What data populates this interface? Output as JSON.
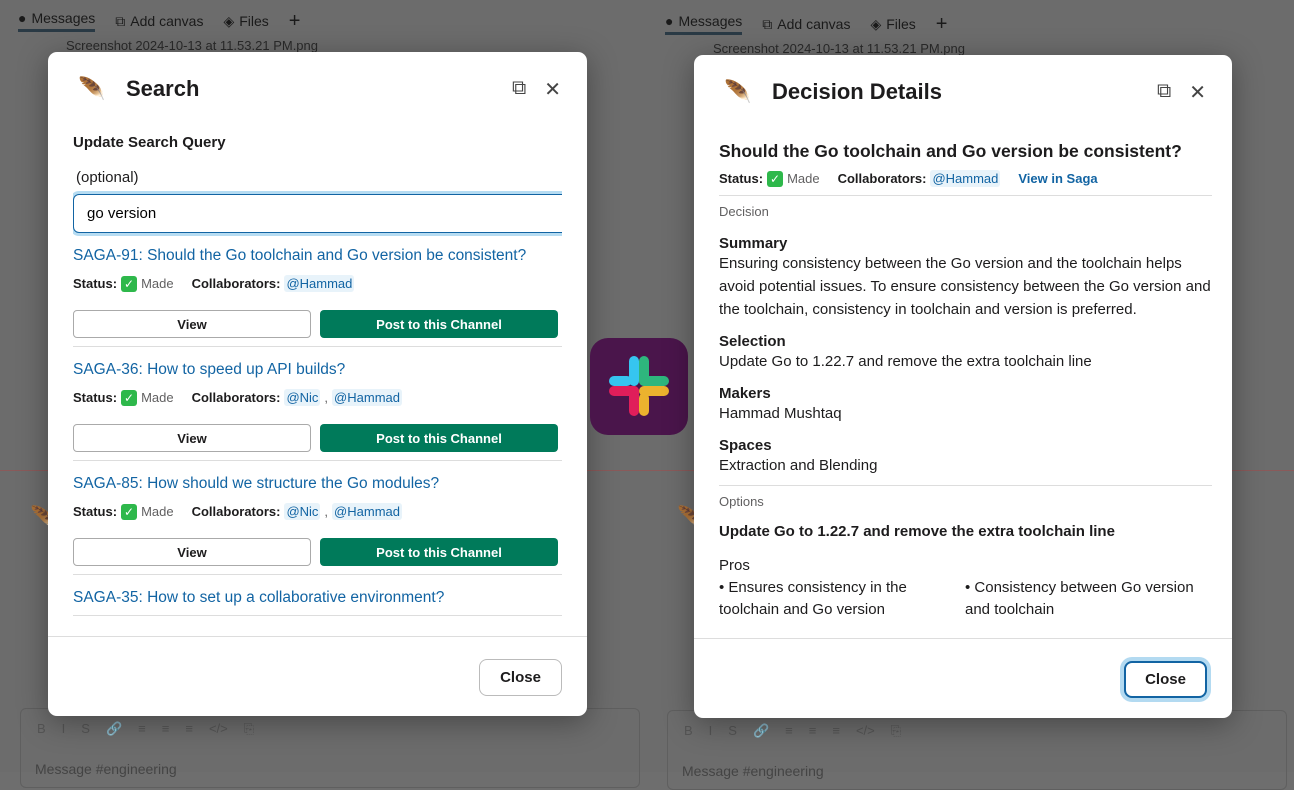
{
  "background": {
    "tabs": [
      {
        "icon": "message-bubble-icon",
        "label": "Messages"
      },
      {
        "icon": "canvas-icon",
        "label": "Add canvas"
      },
      {
        "icon": "layers-icon",
        "label": "Files"
      }
    ],
    "add_tab": "+",
    "file_name": "Screenshot 2024-10-13 at 11.53.21 PM.png",
    "composer_placeholder": "Message #engineering",
    "format_buttons": [
      "B",
      "I",
      "S",
      "🔗",
      "≡",
      "≡",
      "≡",
      "</>",
      "⎘"
    ]
  },
  "search_modal": {
    "title": "Search",
    "label": "Update Search Query",
    "hint": "(optional)",
    "query": "go version",
    "results": [
      {
        "title": "SAGA-91: Should the Go toolchain and Go version be consistent?",
        "status_label": "Status:",
        "status": "Made",
        "collab_label": "Collaborators:",
        "collaborators": [
          "@Hammad"
        ]
      },
      {
        "title": "SAGA-36: How to speed up API builds?",
        "status_label": "Status:",
        "status": "Made",
        "collab_label": "Collaborators:",
        "collaborators": [
          "@Nic",
          "@Hammad"
        ]
      },
      {
        "title": "SAGA-85: How should we structure the Go modules?",
        "status_label": "Status:",
        "status": "Made",
        "collab_label": "Collaborators:",
        "collaborators": [
          "@Nic",
          "@Hammad"
        ]
      },
      {
        "title": "SAGA-35: How to set up a collaborative environment?"
      }
    ],
    "view_label": "View",
    "post_label": "Post to this Channel",
    "close_label": "Close"
  },
  "details_modal": {
    "title": "Decision Details",
    "question": "Should the Go toolchain and Go version be consistent?",
    "status_label": "Status:",
    "status": "Made",
    "collab_label": "Collaborators:",
    "collaborator": "@Hammad",
    "view_link": "View in Saga",
    "decision_header": "Decision",
    "summary_h": "Summary",
    "summary": "Ensuring consistency between the Go version and the toolchain helps avoid potential issues. To ensure consistency between the Go version and the toolchain, consistency in toolchain and version is preferred.",
    "selection_h": "Selection",
    "selection": "Update Go to 1.22.7 and remove the extra toolchain line",
    "makers_h": "Makers",
    "makers": "Hammad Mushtaq",
    "spaces_h": "Spaces",
    "spaces": "Extraction and Blending",
    "options_header": "Options",
    "option_title": "Update Go to 1.22.7 and remove the extra toolchain line",
    "pros_h": "Pros",
    "pros": [
      "• Ensures consistency in the toolchain and Go version",
      "• Consistency between Go version and toolchain"
    ],
    "close_label": "Close"
  },
  "colors": {
    "primary": "#007a5a",
    "link": "#1264a3",
    "slack_bg": "#4a154b"
  }
}
